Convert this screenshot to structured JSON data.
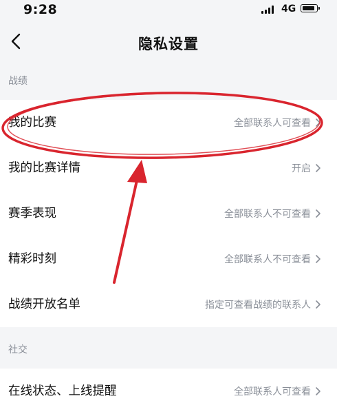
{
  "status": {
    "time": "9:28",
    "network": "4G"
  },
  "nav": {
    "title": "隐私设置"
  },
  "sections": [
    {
      "header": "战绩",
      "rows": [
        {
          "label": "我的比赛",
          "value": "全部联系人可查看"
        },
        {
          "label": "我的比赛详情",
          "value": "开启"
        },
        {
          "label": "赛季表现",
          "value": "全部联系人不可查看"
        },
        {
          "label": "精彩时刻",
          "value": "全部联系人不可查看"
        },
        {
          "label": "战绩开放名单",
          "value": "指定可查看战绩的联系人"
        }
      ]
    },
    {
      "header": "社交",
      "rows": [
        {
          "label": "在线状态、上线提醒",
          "value": "全部联系人可查看"
        }
      ]
    }
  ],
  "annotation_color": "#d9252e"
}
